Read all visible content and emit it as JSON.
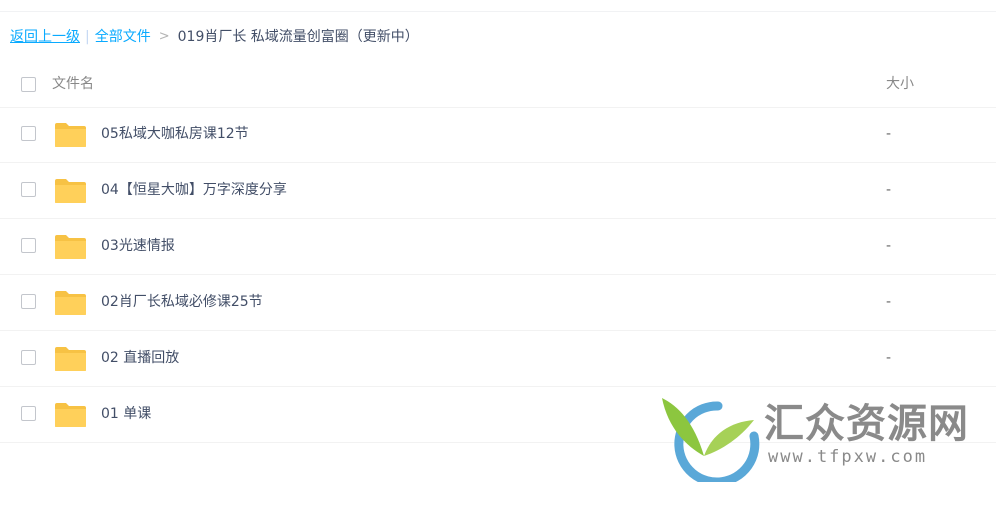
{
  "breadcrumb": {
    "back_label": "返回上一级",
    "separator": "|",
    "all_files_label": "全部文件",
    "arrow": ">",
    "current": "019肖厂长 私域流量创富圈（更新中）"
  },
  "header": {
    "name_label": "文件名",
    "size_label": "大小"
  },
  "files": [
    {
      "name": "05私域大咖私房课12节",
      "size": "-",
      "icon": "folder-icon"
    },
    {
      "name": "04【恒星大咖】万字深度分享",
      "size": "-",
      "icon": "folder-icon"
    },
    {
      "name": "03光速情报",
      "size": "-",
      "icon": "folder-icon"
    },
    {
      "name": "02肖厂长私域必修课25节",
      "size": "-",
      "icon": "folder-icon"
    },
    {
      "name": "02 直播回放",
      "size": "-",
      "icon": "folder-icon"
    },
    {
      "name": "01 单课",
      "size": "",
      "icon": "folder-icon"
    }
  ],
  "watermark": {
    "title": "汇众资源网",
    "url": "www.tfpxw.com"
  },
  "colors": {
    "link": "#09aaff",
    "folder": "#ffd05a",
    "text": "#424e67"
  }
}
